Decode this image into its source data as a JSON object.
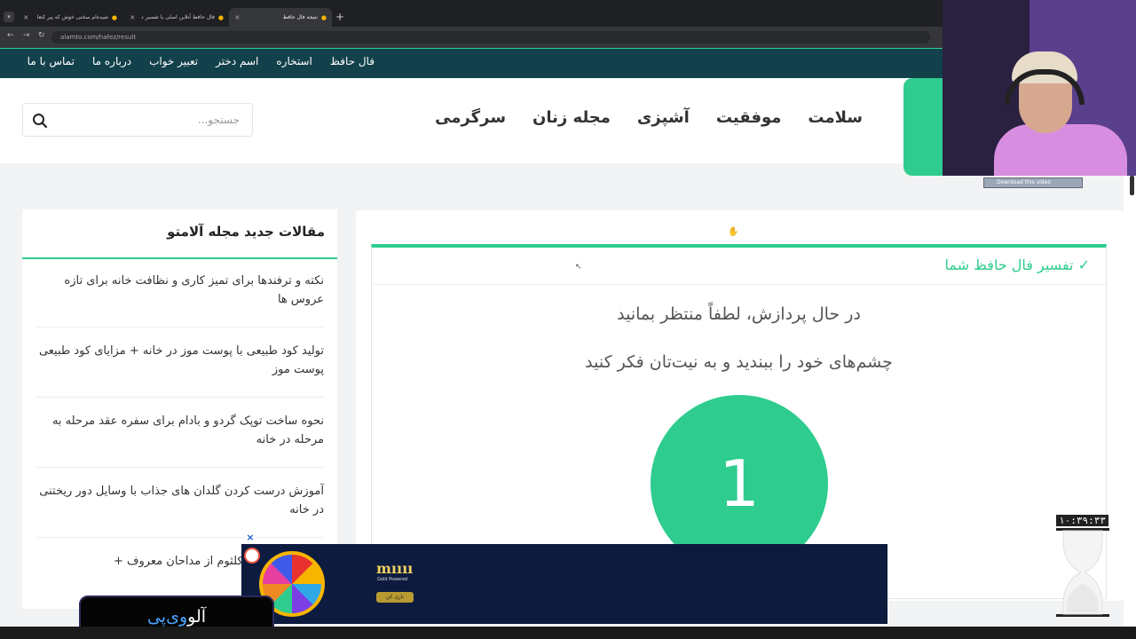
{
  "browser": {
    "tabs": [
      {
        "label": "شیده‌ام سخنی خوش که پیر کنعا"
      },
      {
        "label": "فال حافظ آنلاین اصلی با تفسیر د"
      },
      {
        "label": "نتیجه فال حافظ"
      }
    ],
    "new_tab": "+",
    "url": "alamto.com/hafez/result"
  },
  "top_nav": {
    "items": [
      "فال حافظ",
      "استخاره",
      "اسم دختر",
      "تعبیر خواب",
      "درباره ما",
      "تماس با ما"
    ]
  },
  "header": {
    "main_nav": [
      "سلامت",
      "موفقیت",
      "آشپزی",
      "مجله زنان",
      "سرگرمی"
    ],
    "search_placeholder": "جستجو..."
  },
  "result": {
    "title": "✓ تفسیر فال حافظ شما",
    "msg1": "در حال پردازش، لطفاً منتظر بمانید",
    "msg2": "چشم‌های خود را ببندید و به نیت‌تان فکر کنید",
    "counter": "1"
  },
  "sidebar": {
    "title": "مقالات جدید مجله آلامتو",
    "articles": [
      "نکته و ترفندها برای تمیز کاری و نظافت خانه برای تازه عروس ها",
      "تولید کود طبیعی با پوست موز در خانه + مزایای کود طبیعی پوست موز",
      "نحوه ساخت توپک گردو و بادام برای سفره عقد مرحله به مرحله در خانه",
      "آموزش درست کردن گلدان های جذاب با وسایل دور ریختنی در خانه",
      "مرثیه حضرت ام کلثوم از مداحان معروف +"
    ]
  },
  "ad": {
    "brand": "mıııı",
    "sub": "Gold Powered",
    "button": "بازی کن",
    "close": "×"
  },
  "overlay": {
    "download_video": "Download this video",
    "timer": "۱۰:۳۹:۳۳",
    "brand_a": "آلو",
    "brand_b": "وی‌پی"
  },
  "colors": {
    "accent": "#2ecc8e",
    "topnav": "#13414b"
  }
}
